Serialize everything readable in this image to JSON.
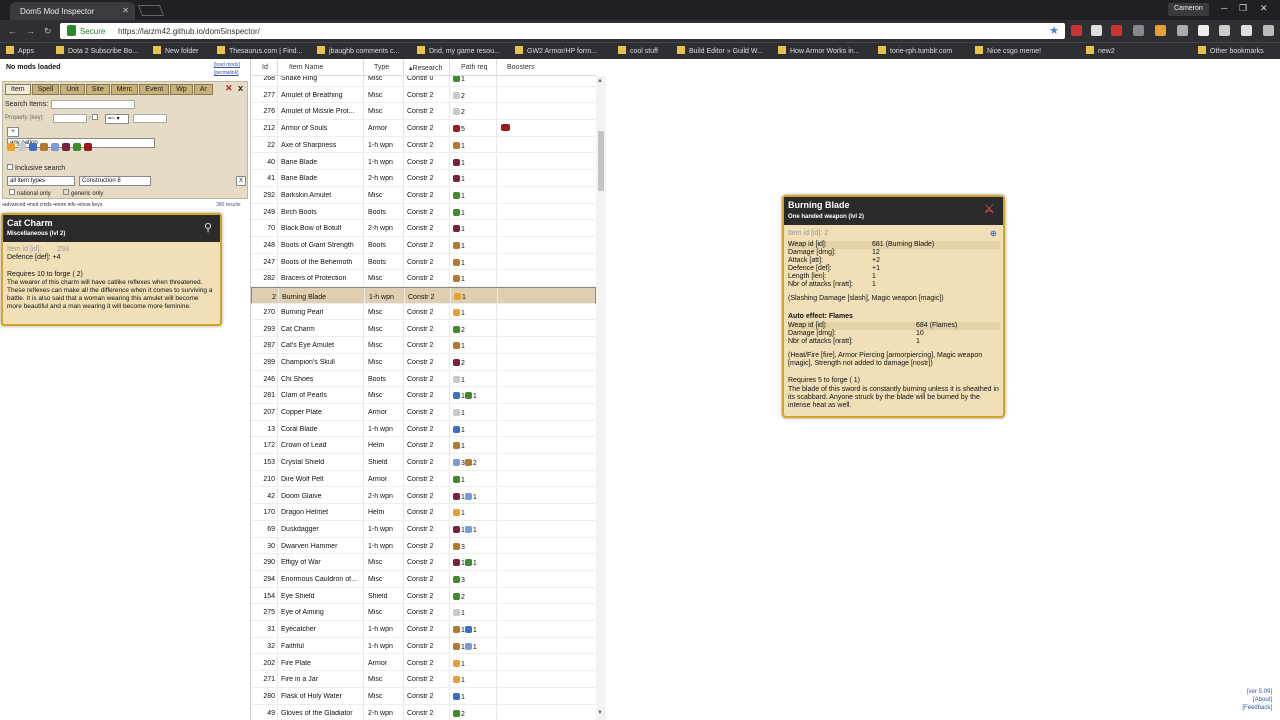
{
  "browser": {
    "tab_title": "Dom5 Mod Inspector",
    "tab_close": "✕",
    "user": "Cameron",
    "secure": "Secure",
    "url": "https://larzm42.github.io/dom5inspector/",
    "bookmarks": [
      "Apps",
      "Dota 2 Subscribe Bo...",
      "New folder",
      "Thesaurus.com | Find...",
      "jbaughb comments c...",
      "Dnd, my game resou...",
      "GW2 Armor/HP form...",
      "cool stuff",
      "Build Editor » Guild W...",
      "How Armor Works in...",
      "torie-rph.tumblr.com",
      "Nice csgo meme!",
      "new2",
      "Other bookmarks"
    ]
  },
  "left": {
    "no_mods": "No mods loaded",
    "load_mods": "[load mods]",
    "permalink": "[permalink]",
    "tabs": [
      "Item",
      "Spell",
      "Unit",
      "Site",
      "Merc",
      "Event",
      "Wp",
      "Ar"
    ],
    "search_label": "Search Items:",
    "property_label": "Property (key):",
    "op": "=~ ▾",
    "add": "+",
    "nation": "any nation",
    "inclusive": "Inclusive search",
    "types": "all item types",
    "construction": "Construction 8",
    "clear": "X",
    "national_only": "national only",
    "generic_only": "generic only",
    "links": "▪advanced  ▪mod cmds  ▪more info  ▪show keys",
    "results": "380 results"
  },
  "card": {
    "title": "Cat Charm",
    "subtitle": "Miscellaneous (lvl 2)",
    "item_id_label": "Item id [id]:",
    "item_id": "293",
    "def_label": "Defence [def]:",
    "def": "+4",
    "requires": "Requires 10 to forge ( 2)",
    "desc": "The wearer of this charm will have catlike reflexes when threatened. These reflexes can make all the difference when it comes to surviving a battle. It is also said that a woman wearing this amulet will become more beautiful and a man wearing it will become more feminine."
  },
  "table": {
    "headers": [
      "Id",
      "Item Name",
      "Type",
      "▴Research",
      "Path req",
      "Boosters"
    ],
    "rows": [
      [
        "268",
        "Snake Ring",
        "Misc",
        "Constr 0",
        "N1",
        ""
      ],
      [
        "277",
        "Amulet of Breathing",
        "Misc",
        "Constr 2",
        "A2",
        ""
      ],
      [
        "276",
        "Amulet of Missile Prot...",
        "Misc",
        "Constr 2",
        "A2",
        ""
      ],
      [
        "212",
        "Armor of Souls",
        "Armor",
        "Constr 2",
        "D5",
        "D"
      ],
      [
        "22",
        "Axe of Sharpness",
        "1-h wpn",
        "Constr 2",
        "E1",
        ""
      ],
      [
        "40",
        "Bane Blade",
        "1-h wpn",
        "Constr 2",
        "B1",
        ""
      ],
      [
        "41",
        "Bane Blade",
        "2-h wpn",
        "Constr 2",
        "B1",
        ""
      ],
      [
        "292",
        "Barkskin Amulet",
        "Misc",
        "Constr 2",
        "N1",
        ""
      ],
      [
        "249",
        "Birch Boots",
        "Boots",
        "Constr 2",
        "N1",
        ""
      ],
      [
        "70",
        "Black Bow of Botulf",
        "2-h wpn",
        "Constr 2",
        "B1",
        ""
      ],
      [
        "248",
        "Boots of Giant Strength",
        "Boots",
        "Constr 2",
        "E1",
        ""
      ],
      [
        "247",
        "Boots of the Behemoth",
        "Boots",
        "Constr 2",
        "E1",
        ""
      ],
      [
        "282",
        "Bracers of Protection",
        "Misc",
        "Constr 2",
        "E1",
        ""
      ],
      [
        "2",
        "Burning Blade",
        "1-h wpn",
        "Constr 2",
        "F1",
        ""
      ],
      [
        "270",
        "Burning Pearl",
        "Misc",
        "Constr 2",
        "F1",
        ""
      ],
      [
        "293",
        "Cat Charm",
        "Misc",
        "Constr 2",
        "N2",
        ""
      ],
      [
        "287",
        "Cat's Eye Amulet",
        "Misc",
        "Constr 2",
        "E1",
        ""
      ],
      [
        "289",
        "Champion's Skull",
        "Misc",
        "Constr 2",
        "B2",
        ""
      ],
      [
        "246",
        "Chi Shoes",
        "Boots",
        "Constr 2",
        "A1",
        ""
      ],
      [
        "281",
        "Clam of Pearls",
        "Misc",
        "Constr 2",
        "W1N1",
        ""
      ],
      [
        "207",
        "Copper Plate",
        "Armor",
        "Constr 2",
        "A1",
        ""
      ],
      [
        "13",
        "Coral Blade",
        "1-h wpn",
        "Constr 2",
        "W1",
        ""
      ],
      [
        "172",
        "Crown of Lead",
        "Helm",
        "Constr 2",
        "E1",
        ""
      ],
      [
        "153",
        "Crystal Shield",
        "Shield",
        "Constr 2",
        "S3E2",
        ""
      ],
      [
        "210",
        "Dire Wolf Pelt",
        "Armor",
        "Constr 2",
        "N1",
        ""
      ],
      [
        "42",
        "Doom Glaive",
        "2-h wpn",
        "Constr 2",
        "B1S1",
        ""
      ],
      [
        "170",
        "Dragon Helmet",
        "Helm",
        "Constr 2",
        "F1",
        ""
      ],
      [
        "69",
        "Duskdagger",
        "1-h wpn",
        "Constr 2",
        "B1S1",
        ""
      ],
      [
        "30",
        "Dwarven Hammer",
        "1-h wpn",
        "Constr 2",
        "E3",
        ""
      ],
      [
        "290",
        "Effigy of War",
        "Misc",
        "Constr 2",
        "B1N1",
        ""
      ],
      [
        "294",
        "Enormous Cauldron of...",
        "Misc",
        "Constr 2",
        "N3",
        ""
      ],
      [
        "154",
        "Eye Shield",
        "Shield",
        "Constr 2",
        "N2",
        ""
      ],
      [
        "275",
        "Eye of Aiming",
        "Misc",
        "Constr 2",
        "A1",
        ""
      ],
      [
        "31",
        "Eyecatcher",
        "1-h wpn",
        "Constr 2",
        "E1W1",
        ""
      ],
      [
        "32",
        "Faithful",
        "1-h wpn",
        "Constr 2",
        "E1S1",
        ""
      ],
      [
        "202",
        "Fire Plate",
        "Armor",
        "Constr 2",
        "F1",
        ""
      ],
      [
        "271",
        "Fire in a Jar",
        "Misc",
        "Constr 2",
        "F1",
        ""
      ],
      [
        "280",
        "Flask of Holy Water",
        "Misc",
        "Constr 2",
        "W1",
        ""
      ],
      [
        "49",
        "Gloves of the Gladiator",
        "2-h wpn",
        "Constr 2",
        "N2",
        ""
      ]
    ]
  },
  "popup": {
    "title": "Burning Blade",
    "subtitle": "One handed weapon (lvl 2)",
    "item_id_label": "Item id [id]:",
    "item_id": "2",
    "weap_rows": [
      [
        "Weap id [id]:",
        "681 (Burning Blade)"
      ],
      [
        "Damage [dmg]:",
        "12"
      ],
      [
        "Attack [att]:",
        "+2"
      ],
      [
        "Defence [def]:",
        "+1"
      ],
      [
        "Length [len]:",
        "1"
      ],
      [
        "Nbr of attacks [nratt]:",
        "1"
      ]
    ],
    "flags1": "(Slashing Damage [slash], Magic weapon [magic])",
    "auto_effect": "Auto effect: Flames",
    "eff_rows": [
      [
        "Weap id [id]:",
        "684 (Flames)"
      ],
      [
        "Damage [dmg]:",
        "10"
      ],
      [
        "Nbr of attacks [nratt]:",
        "1"
      ]
    ],
    "flags2": "(Heat/Fire [fire], Armor Piercing [armorpiercing], Magic weapon [magic], Strength not added to damage [nostr])",
    "requires": "Requires 5 to forge ( 1)",
    "desc": "The blade of this sword is constantly burning unless it is sheathed in its scabbard. Anyone struck by the blade will be burned by the intense heat as well."
  },
  "footer": {
    "version": "[ver 5.09]",
    "about": "[About]",
    "feedback": "[Feedback]"
  },
  "colors": {
    "F": "#e8a030",
    "A": "#c9c9c9",
    "W": "#3d6fc6",
    "E": "#b07a2a",
    "S": "#7a9ad8",
    "D": "#9a1b1b",
    "N": "#3f8a2a",
    "B": "#7a2040"
  }
}
